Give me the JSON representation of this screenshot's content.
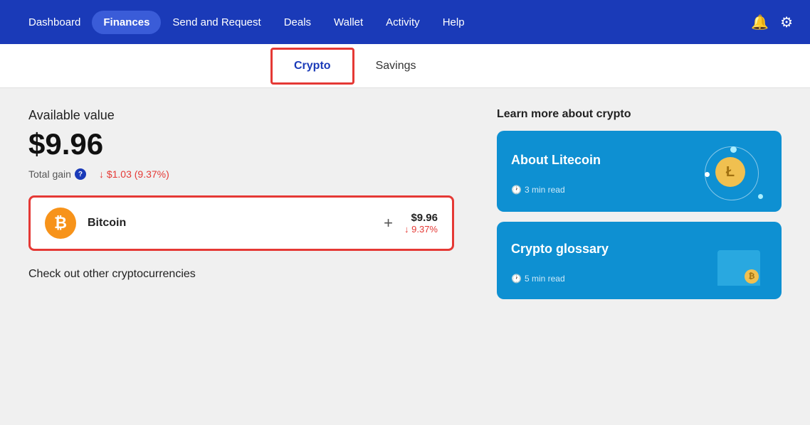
{
  "navbar": {
    "items": [
      {
        "label": "Dashboard",
        "active": false
      },
      {
        "label": "Finances",
        "active": true
      },
      {
        "label": "Send and Request",
        "active": false
      },
      {
        "label": "Deals",
        "active": false
      },
      {
        "label": "Wallet",
        "active": false
      },
      {
        "label": "Activity",
        "active": false
      },
      {
        "label": "Help",
        "active": false
      }
    ],
    "bell_icon": "🔔",
    "gear_icon": "⚙"
  },
  "sub_tabs": [
    {
      "label": "Crypto",
      "active": true
    },
    {
      "label": "Savings",
      "active": false
    }
  ],
  "left": {
    "available_label": "Available value",
    "available_value": "$9.96",
    "total_gain_label": "Total gain",
    "total_gain_value": "↓ $1.03 (9.37%)",
    "crypto_card": {
      "name": "Bitcoin",
      "price": "$9.96",
      "change": "↓ 9.37%",
      "plus": "+"
    },
    "check_other": "Check out other cryptocurrencies"
  },
  "right": {
    "learn_label": "Learn more about crypto",
    "cards": [
      {
        "title": "About Litecoin",
        "meta": "3 min read"
      },
      {
        "title": "Crypto glossary",
        "meta": "5 min read"
      }
    ]
  }
}
